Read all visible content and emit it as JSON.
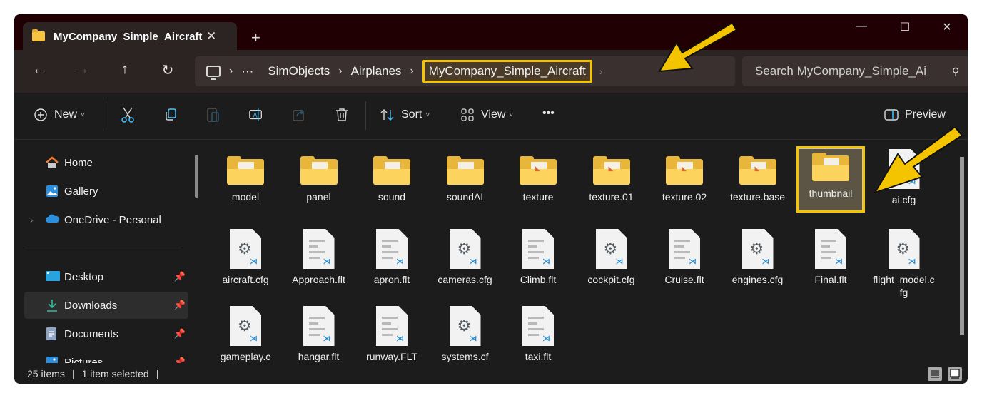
{
  "window": {
    "tab_title": "MyCompany_Simple_Aircraft",
    "tab_close": "✕",
    "new_tab": "+",
    "minimize": "—",
    "maximize": "☐",
    "close": "✕"
  },
  "nav": {
    "back": "←",
    "forward": "→",
    "up": "↑",
    "refresh": "↻"
  },
  "address": {
    "overflow": "···",
    "separator": "›",
    "crumbs": [
      "SimObjects",
      "Airplanes",
      "MyCompany_Simple_Aircraft"
    ]
  },
  "search": {
    "placeholder": "Search MyCompany_Simple_Ai",
    "icon": "⚲"
  },
  "toolbar": {
    "new_label": "New",
    "sort_label": "Sort",
    "view_label": "View",
    "more_label": "•••",
    "preview_label": "Preview",
    "chevron": "˅"
  },
  "sidebar": {
    "items": [
      {
        "label": "Home",
        "pinned": false,
        "expandable": false
      },
      {
        "label": "Gallery",
        "pinned": false,
        "expandable": false
      },
      {
        "label": "OneDrive - Personal",
        "pinned": false,
        "expandable": true
      },
      {
        "label": "Desktop",
        "pinned": true,
        "expandable": false
      },
      {
        "label": "Downloads",
        "pinned": true,
        "expandable": false,
        "selected": true
      },
      {
        "label": "Documents",
        "pinned": true,
        "expandable": false
      },
      {
        "label": "Pictures",
        "pinned": true,
        "expandable": false
      }
    ],
    "pin_glyph": "📌",
    "expand_glyph": "›"
  },
  "files": [
    {
      "name": "model",
      "type": "folder"
    },
    {
      "name": "panel",
      "type": "folder"
    },
    {
      "name": "sound",
      "type": "folder"
    },
    {
      "name": "soundAI",
      "type": "folder"
    },
    {
      "name": "texture",
      "type": "folder-image"
    },
    {
      "name": "texture.01",
      "type": "folder-image"
    },
    {
      "name": "texture.02",
      "type": "folder-image"
    },
    {
      "name": "texture.base",
      "type": "folder-image"
    },
    {
      "name": "thumbnail",
      "type": "folder",
      "selected": true
    },
    {
      "name": "ai.cfg",
      "type": "cfg"
    },
    {
      "name": "aircraft.cfg",
      "type": "cfg"
    },
    {
      "name": "Approach.flt",
      "type": "flt"
    },
    {
      "name": "apron.flt",
      "type": "flt"
    },
    {
      "name": "cameras.cfg",
      "type": "cfg"
    },
    {
      "name": "Climb.flt",
      "type": "flt"
    },
    {
      "name": "cockpit.cfg",
      "type": "cfg"
    },
    {
      "name": "Cruise.flt",
      "type": "flt"
    },
    {
      "name": "engines.cfg",
      "type": "cfg"
    },
    {
      "name": "Final.flt",
      "type": "flt"
    },
    {
      "name": "flight_model.cfg",
      "type": "cfg"
    },
    {
      "name": "gameplay.c",
      "type": "cfg"
    },
    {
      "name": "hangar.flt",
      "type": "flt"
    },
    {
      "name": "runway.FLT",
      "type": "flt"
    },
    {
      "name": "systems.cf",
      "type": "cfg"
    },
    {
      "name": "taxi.flt",
      "type": "flt"
    }
  ],
  "status": {
    "item_count": "25 items",
    "selection": "1 item selected",
    "divider": "|"
  },
  "colors": {
    "highlight": "#f5c400",
    "titlebar": "#200003",
    "accent": "#4cc2ff"
  }
}
